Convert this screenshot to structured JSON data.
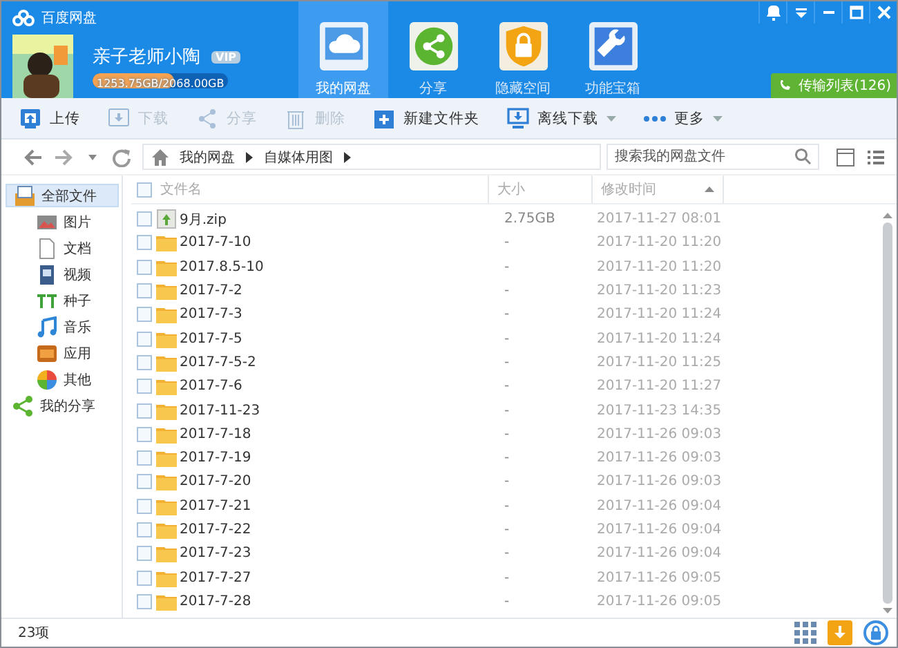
{
  "app": {
    "title": "百度网盘"
  },
  "user": {
    "name": "亲子老师小陶",
    "badge": "VIP",
    "storage": {
      "text": "1253.75GB/2068.00GB",
      "level": 0.606
    }
  },
  "tabs": [
    {
      "label": "我的网盘",
      "selected": true
    },
    {
      "label": "分享",
      "selected": false
    },
    {
      "label": "隐藏空间",
      "selected": false
    },
    {
      "label": "功能宝箱",
      "selected": false
    }
  ],
  "transfer_button": {
    "label": "传输列表(126)"
  },
  "toolbar": [
    {
      "label": "上传",
      "disabled": false,
      "dropdown": false
    },
    {
      "label": "下载",
      "disabled": true,
      "dropdown": false
    },
    {
      "label": "分享",
      "disabled": true,
      "dropdown": false
    },
    {
      "label": "删除",
      "disabled": true,
      "dropdown": false
    },
    {
      "label": "新建文件夹",
      "disabled": false,
      "dropdown": false
    },
    {
      "label": "离线下载",
      "disabled": false,
      "dropdown": true
    },
    {
      "label": "更多",
      "disabled": false,
      "dropdown": true
    }
  ],
  "breadcrumb": [
    "我的网盘",
    "自媒体用图"
  ],
  "search": {
    "placeholder": "搜索我的网盘文件"
  },
  "sidebar": {
    "items": [
      {
        "label": "全部文件",
        "selected": true,
        "children": [
          {
            "label": "图片",
            "selected": false
          },
          {
            "label": "文档",
            "selected": false
          },
          {
            "label": "视频",
            "selected": false
          },
          {
            "label": "种子",
            "selected": false
          },
          {
            "label": "音乐",
            "selected": false
          },
          {
            "label": "应用",
            "selected": false
          },
          {
            "label": "其他",
            "selected": false
          }
        ]
      },
      {
        "label": "我的分享",
        "selected": false
      }
    ]
  },
  "table": {
    "select_all_checked": false,
    "columns": [
      {
        "label": "文件名",
        "sorted": false
      },
      {
        "label": "大小",
        "sorted": false
      },
      {
        "label": "修改时间",
        "sorted": true
      }
    ],
    "rows": [
      {
        "kind": "zip",
        "name": "9月.zip",
        "size": "2.75GB",
        "modified": "2017-11-27 08:01",
        "checked": false
      },
      {
        "kind": "folder",
        "name": "2017-7-10",
        "size": "-",
        "modified": "2017-11-20 11:20",
        "checked": false
      },
      {
        "kind": "folder",
        "name": "2017.8.5-10",
        "size": "-",
        "modified": "2017-11-20 11:20",
        "checked": false
      },
      {
        "kind": "folder",
        "name": "2017-7-2",
        "size": "-",
        "modified": "2017-11-20 11:23",
        "checked": false
      },
      {
        "kind": "folder",
        "name": "2017-7-3",
        "size": "-",
        "modified": "2017-11-20 11:24",
        "checked": false
      },
      {
        "kind": "folder",
        "name": "2017-7-5",
        "size": "-",
        "modified": "2017-11-20 11:24",
        "checked": false
      },
      {
        "kind": "folder",
        "name": "2017-7-5-2",
        "size": "-",
        "modified": "2017-11-20 11:25",
        "checked": false
      },
      {
        "kind": "folder",
        "name": "2017-7-6",
        "size": "-",
        "modified": "2017-11-20 11:27",
        "checked": false
      },
      {
        "kind": "folder",
        "name": "2017-11-23",
        "size": "-",
        "modified": "2017-11-23 14:35",
        "checked": false
      },
      {
        "kind": "folder",
        "name": "2017-7-18",
        "size": "-",
        "modified": "2017-11-26 09:03",
        "checked": false
      },
      {
        "kind": "folder",
        "name": "2017-7-19",
        "size": "-",
        "modified": "2017-11-26 09:03",
        "checked": false
      },
      {
        "kind": "folder",
        "name": "2017-7-20",
        "size": "-",
        "modified": "2017-11-26 09:03",
        "checked": false
      },
      {
        "kind": "folder",
        "name": "2017-7-21",
        "size": "-",
        "modified": "2017-11-26 09:04",
        "checked": false
      },
      {
        "kind": "folder",
        "name": "2017-7-22",
        "size": "-",
        "modified": "2017-11-26 09:04",
        "checked": false
      },
      {
        "kind": "folder",
        "name": "2017-7-23",
        "size": "-",
        "modified": "2017-11-26 09:04",
        "checked": false
      },
      {
        "kind": "folder",
        "name": "2017-7-27",
        "size": "-",
        "modified": "2017-11-26 09:05",
        "checked": false
      },
      {
        "kind": "folder",
        "name": "2017-7-28",
        "size": "-",
        "modified": "2017-11-26 09:05",
        "checked": false
      }
    ]
  },
  "status_bar": {
    "count": "23项"
  }
}
